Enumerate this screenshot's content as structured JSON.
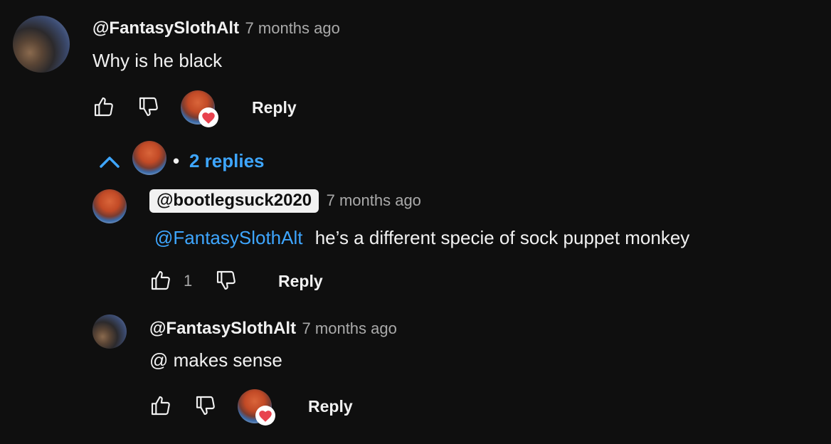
{
  "comments": [
    {
      "handle": "@FantasySlothAlt",
      "time": "7 months ago",
      "text": "Why is he black",
      "reply_label": "Reply"
    }
  ],
  "replies_toggle": {
    "dot": "•",
    "label": "2 replies"
  },
  "replies": [
    {
      "handle": "@bootlegsuck2020",
      "time": "7 months ago",
      "mention": "@FantasySlothAlt",
      "text": "he’s a different specie of sock puppet monkey",
      "like_count": "1",
      "reply_label": "Reply"
    },
    {
      "handle": "@FantasySlothAlt",
      "time": "7 months ago",
      "text": "@ makes sense",
      "reply_label": "Reply"
    }
  ],
  "colors": {
    "background": "#0f0f0f",
    "link": "#3ea6ff",
    "heart": "#e8424e",
    "secondary_text": "#aaaaaa"
  },
  "icons": [
    "thumb-up-icon",
    "thumb-down-icon",
    "heart-icon",
    "chevron-up-icon"
  ]
}
